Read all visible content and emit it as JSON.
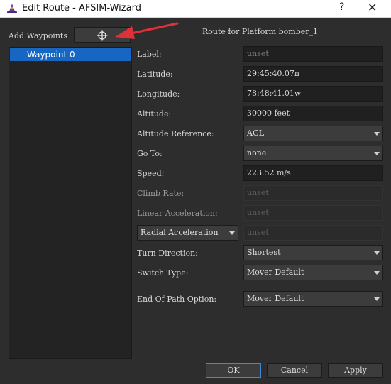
{
  "window": {
    "title": "Edit Route - AFSIM-Wizard",
    "help_glyph": "?",
    "close_glyph": "✕"
  },
  "left": {
    "add_waypoints_label": "Add Waypoints",
    "waypoints": [
      {
        "label": "Waypoint 0"
      }
    ]
  },
  "route": {
    "title": "Route for Platform bomber_1",
    "fields": {
      "label": {
        "label": "Label:",
        "placeholder": "unset"
      },
      "latitude": {
        "label": "Latitude:",
        "value": "29:45:40.07n"
      },
      "longitude": {
        "label": "Longitude:",
        "value": "78:48:41.01w"
      },
      "altitude": {
        "label": "Altitude:",
        "value": "30000 feet"
      },
      "altitude_reference": {
        "label": "Altitude Reference:",
        "value": "AGL"
      },
      "go_to": {
        "label": "Go To:",
        "value": "none"
      },
      "speed": {
        "label": "Speed:",
        "value": "223.52 m/s"
      },
      "climb_rate": {
        "label": "Climb Rate:",
        "placeholder": "unset"
      },
      "linear_acceleration": {
        "label": "Linear Acceleration:",
        "placeholder": "unset"
      },
      "radial_acceleration": {
        "selector": "Radial Acceleration",
        "placeholder": "unset"
      },
      "turn_direction": {
        "label": "Turn Direction:",
        "value": "Shortest"
      },
      "switch_type": {
        "label": "Switch Type:",
        "value": "Mover Default"
      },
      "end_of_path": {
        "label": "End Of Path Option:",
        "value": "Mover Default"
      }
    }
  },
  "buttons": {
    "ok": "OK",
    "cancel": "Cancel",
    "apply": "Apply"
  },
  "colors": {
    "selection": "#1767c2",
    "annotation_arrow": "#e0303a",
    "background": "#2d2d2d"
  },
  "icons": {
    "app": "wizard-hat-icon",
    "add_waypoint": "crosshair-icon"
  }
}
